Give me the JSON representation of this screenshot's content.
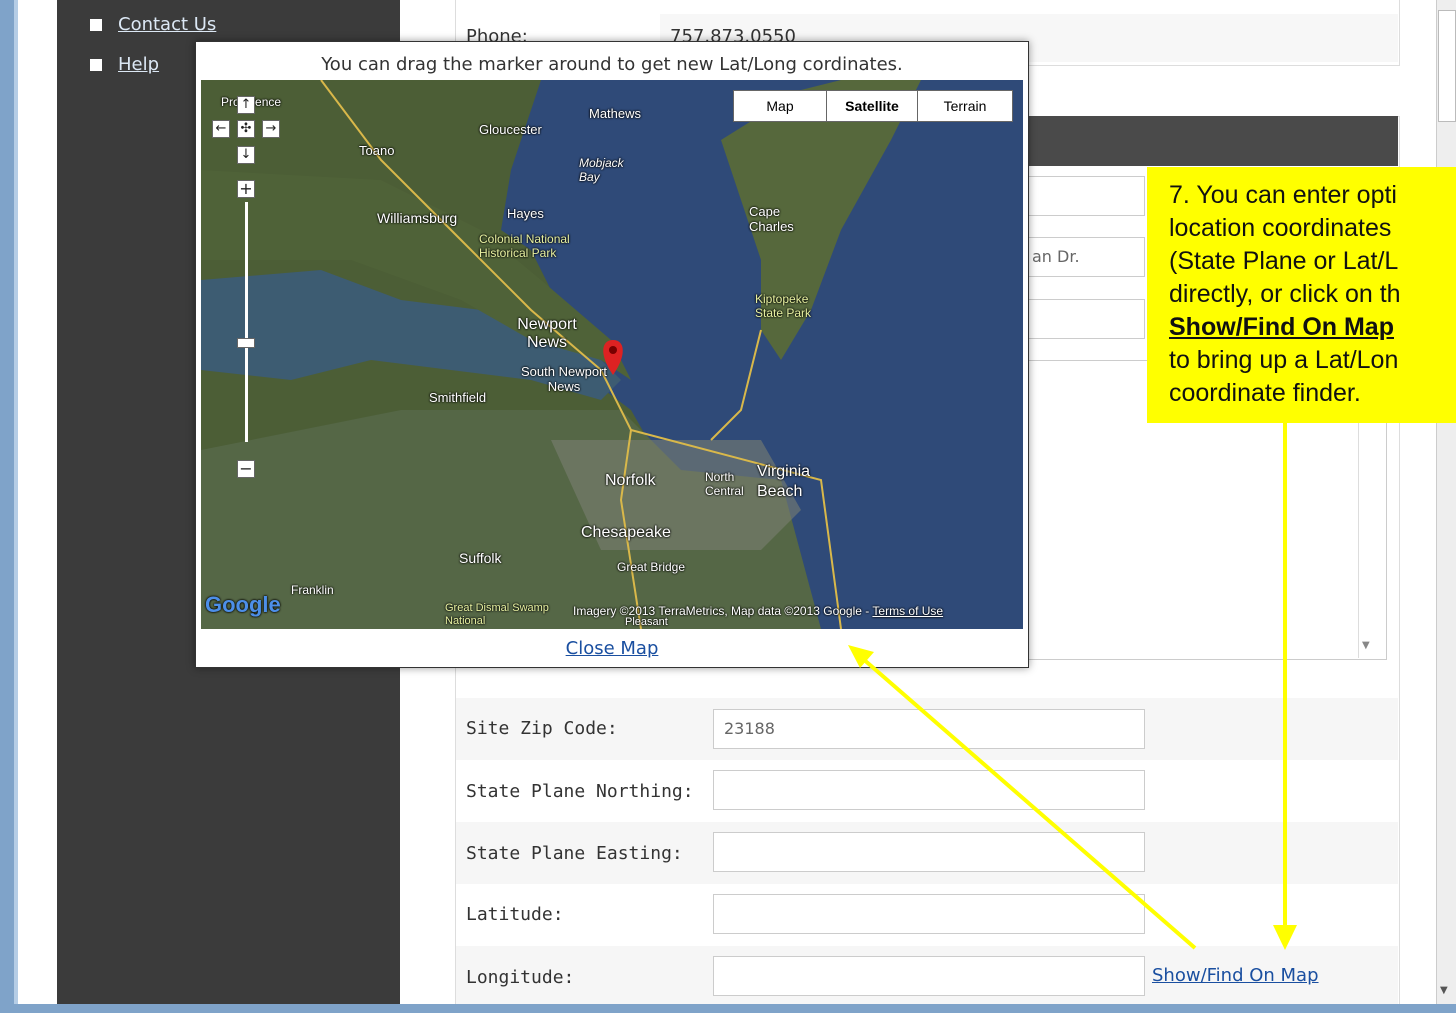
{
  "sidebar": {
    "items": [
      {
        "label": "Contact Us"
      },
      {
        "label": "Help"
      }
    ]
  },
  "contact": {
    "phone_label": "Phone:",
    "phone_value": "757.873.0550"
  },
  "form": {
    "partial_address": "an Dr.",
    "rows": [
      {
        "label": "Site Zip Code:",
        "value": "23188"
      },
      {
        "label": "State Plane Northing:",
        "value": ""
      },
      {
        "label": "State Plane Easting:",
        "value": ""
      },
      {
        "label": "Latitude:",
        "value": ""
      },
      {
        "label": "Longitude:",
        "value": ""
      }
    ],
    "show_on_map_link": "Show/Find On Map"
  },
  "map_popup": {
    "title": "You can drag the marker around to get new Lat/Long cordinates.",
    "map_types": [
      "Map",
      "Satellite",
      "Terrain"
    ],
    "selected_map_type": "Satellite",
    "close_link": "Close Map",
    "attribution": "Imagery ©2013 TerraMetrics, Map data ©2013 Google -",
    "terms_link": "Terms of Use",
    "google_logo": "Google",
    "place_labels": [
      "Mathews",
      "Gloucester",
      "Toano",
      "Mobjack Bay",
      "Williamsburg",
      "Hayes",
      "Colonial National Historical Park",
      "Cape Charles",
      "Kiptopeke State Park",
      "Newport News",
      "South Newport News",
      "Smithfield",
      "Norfolk",
      "North Central",
      "Virginia Beach",
      "Chesapeake",
      "Suffolk",
      "Great Bridge",
      "Franklin",
      "Great Dismal Swamp National",
      "Pleasant",
      "Providence"
    ],
    "zoom_in": "+",
    "zoom_out": "−"
  },
  "callout": {
    "lines": [
      "7. You can enter opti",
      "location coordinates",
      "(State Plane or Lat/L",
      "directly, or click on th",
      "Show/Find On Map",
      "to bring up a Lat/Lon",
      "coordinate finder."
    ]
  },
  "colors": {
    "sidebar": "#3b3b3b",
    "callout": "#ffff00",
    "link": "#1a4fa0",
    "water": "#2f4a78",
    "land": "#4c5e36"
  }
}
